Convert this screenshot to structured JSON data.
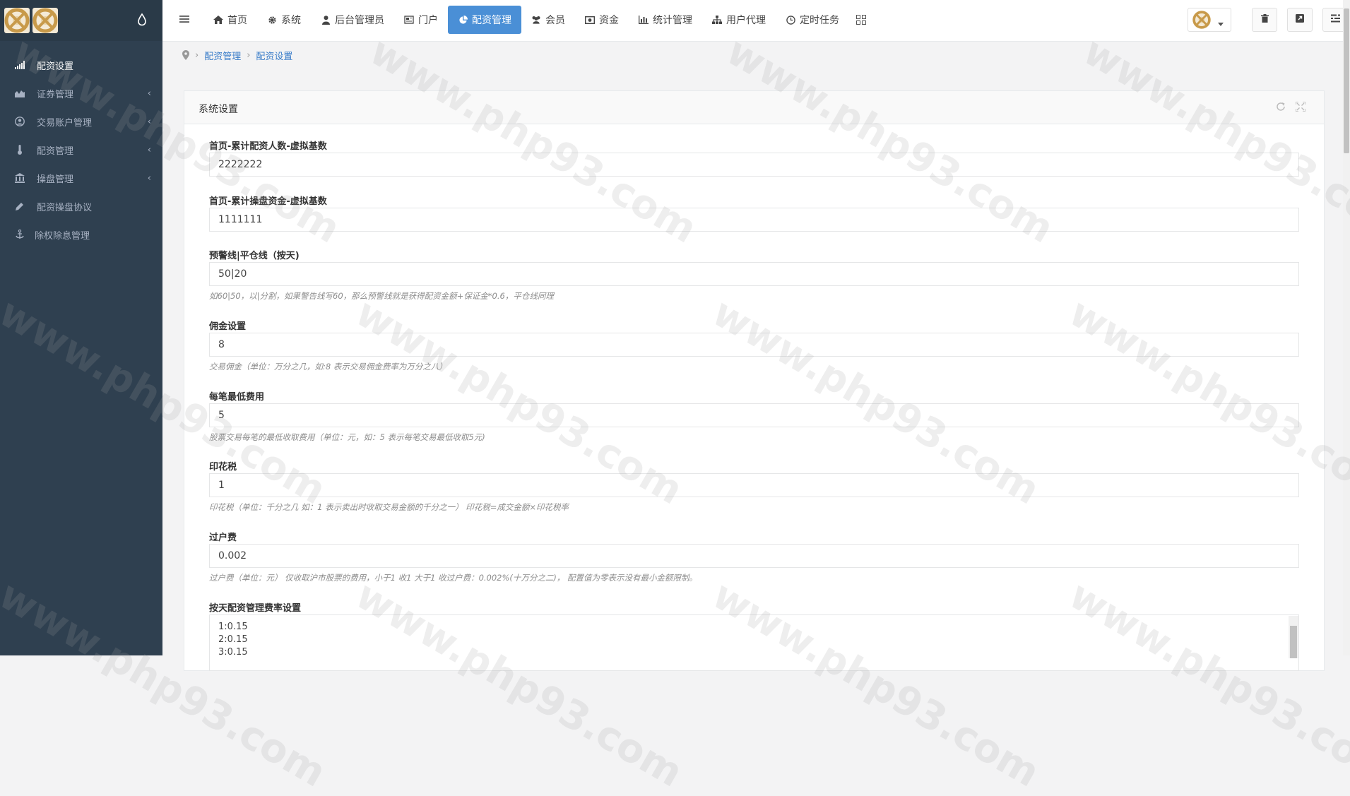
{
  "sidebar": {
    "items": [
      {
        "label": "配资设置",
        "icon": "signal-icon",
        "active": true,
        "has_arrow": false
      },
      {
        "label": "证券管理",
        "icon": "chart-icon",
        "active": false,
        "has_arrow": true
      },
      {
        "label": "交易账户管理",
        "icon": "user-circle-icon",
        "active": false,
        "has_arrow": true
      },
      {
        "label": "配资管理",
        "icon": "thermometer-icon",
        "active": false,
        "has_arrow": true
      },
      {
        "label": "操盘管理",
        "icon": "bank-icon",
        "active": false,
        "has_arrow": true
      },
      {
        "label": "配资操盘协议",
        "icon": "pencil-icon",
        "active": false,
        "has_arrow": false
      },
      {
        "label": "除权除息管理",
        "icon": "anchor-icon",
        "active": false,
        "has_arrow": false
      }
    ],
    "arrow_glyph": "‹"
  },
  "nav": {
    "items": [
      {
        "label": "首页",
        "icon": "home-icon"
      },
      {
        "label": "系统",
        "icon": "gear-icon"
      },
      {
        "label": "后台管理员",
        "icon": "user-icon"
      },
      {
        "label": "门户",
        "icon": "newspaper-icon"
      },
      {
        "label": "配资管理",
        "icon": "pie-chart-icon",
        "active": true
      },
      {
        "label": "会员",
        "icon": "users-icon"
      },
      {
        "label": "资金",
        "icon": "money-icon"
      },
      {
        "label": "统计管理",
        "icon": "bar-chart-icon"
      },
      {
        "label": "用户代理",
        "icon": "sitemap-icon"
      },
      {
        "label": "定时任务",
        "icon": "clock-icon"
      }
    ]
  },
  "breadcrumb": {
    "separator": "›",
    "items": [
      "配资管理",
      "配资设置"
    ]
  },
  "panel": {
    "title": "系统设置"
  },
  "form": {
    "fields": [
      {
        "label": "首页-累计配资人数-虚拟基数",
        "value": "2222222",
        "help": ""
      },
      {
        "label": "首页-累计操盘资金-虚拟基数",
        "value": "1111111",
        "help": ""
      },
      {
        "label": "预警线|平仓线（按天)",
        "value": "50|20",
        "help": "如60|50，以|分割，如果警告线写60，那么预警线就是获得配资金额+保证金*0.6，平仓线同理"
      },
      {
        "label": "佣金设置",
        "value": "8",
        "help": "交易佣金（单位：万分之几，如:8 表示交易佣金费率为万分之八）"
      },
      {
        "label": "每笔最低费用",
        "value": "5",
        "help": "股票交易每笔的最低收取费用（单位：元，如：5 表示每笔交易最低收取5元)"
      },
      {
        "label": "印花税",
        "value": "1",
        "help": "印花税（单位：千分之几 如：1 表示卖出时收取交易金额的千分之一） 印花税=成交金额×印花税率"
      },
      {
        "label": "过户费",
        "value": "0.002",
        "help": "过户费（单位：元） 仅收取沪市股票的费用，小于1 收1 大于1 收过户费：0.002%(十万分之二)， 配置值为零表示没有最小金额限制。"
      }
    ],
    "textarea": {
      "label": "按天配资管理费率设置",
      "value": "1:0.15\n2:0.15\n3:0.15"
    }
  },
  "watermark": {
    "text": "www.php93.com"
  },
  "colors": {
    "sidebar_bg": "#2f4050",
    "active_nav": "#4a8fd6",
    "link": "#3a7dc9"
  }
}
